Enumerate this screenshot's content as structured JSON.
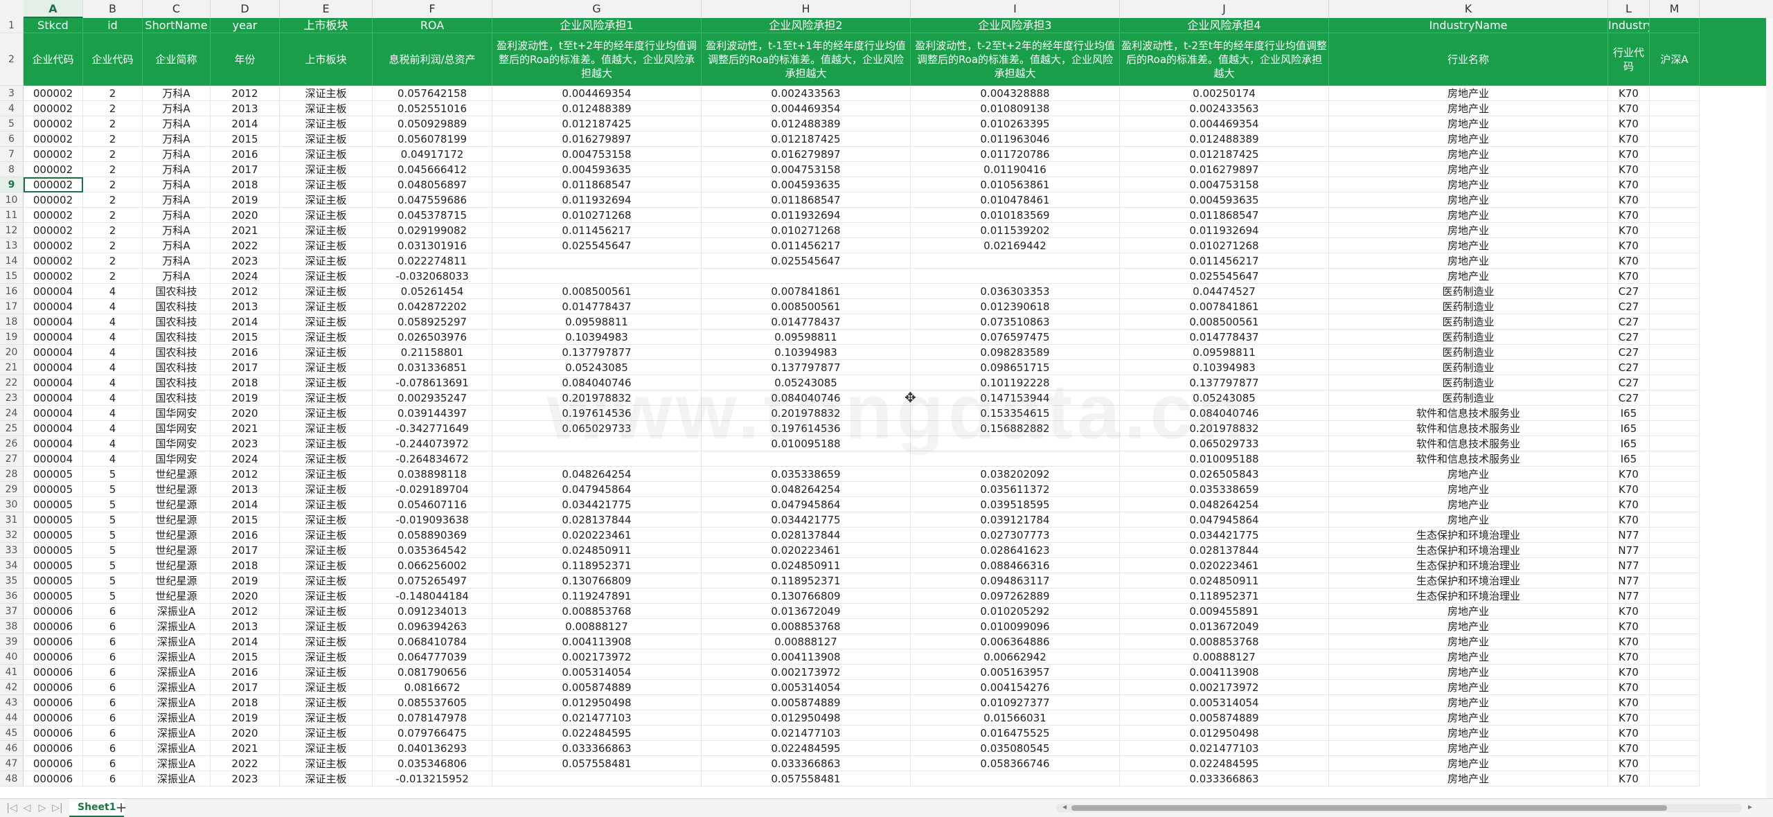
{
  "columns": [
    {
      "letter": "A",
      "name": "Stkcd",
      "name2": "企业代码"
    },
    {
      "letter": "B",
      "name": "id",
      "name2": "企业代码"
    },
    {
      "letter": "C",
      "name": "ShortName",
      "name2": "企业简称"
    },
    {
      "letter": "D",
      "name": "year",
      "name2": "年份"
    },
    {
      "letter": "E",
      "name": "上市板块",
      "name2": "上市板块"
    },
    {
      "letter": "F",
      "name": "ROA",
      "name2": "息税前利润/总资产"
    },
    {
      "letter": "G",
      "name": "企业风险承担1",
      "name2": "盈利波动性，t至t+2年的经年度行业均值调整后的Roa的标准差。值越大，企业风险承担越大"
    },
    {
      "letter": "H",
      "name": "企业风险承担2",
      "name2": "盈利波动性，t-1至t+1年的经年度行业均值调整后的Roa的标准差。值越大，企业风险承担越大"
    },
    {
      "letter": "I",
      "name": "企业风险承担3",
      "name2": "盈利波动性，t-2至t+2年的经年度行业均值调整后的Roa的标准差。值越大，企业风险承担越大"
    },
    {
      "letter": "J",
      "name": "企业风险承担4",
      "name2": "盈利波动性，t-2至t年的经年度行业均值调整后的Roa的标准差。值越大，企业风险承担越大"
    },
    {
      "letter": "K",
      "name": "IndustryName",
      "name2": "行业名称"
    },
    {
      "letter": "L",
      "name": "IndustryCode",
      "name2": "行业代码"
    },
    {
      "letter": "M",
      "name": "",
      "name2": "沪深A"
    }
  ],
  "rows": [
    [
      "000002",
      "2",
      "万科A",
      "2012",
      "深证主板",
      "0.057642158",
      "0.004469354",
      "0.002433563",
      "0.004328888",
      "0.00250174",
      "房地产业",
      "K70"
    ],
    [
      "000002",
      "2",
      "万科A",
      "2013",
      "深证主板",
      "0.052551016",
      "0.012488389",
      "0.004469354",
      "0.010809138",
      "0.002433563",
      "房地产业",
      "K70"
    ],
    [
      "000002",
      "2",
      "万科A",
      "2014",
      "深证主板",
      "0.050929889",
      "0.012187425",
      "0.012488389",
      "0.010263395",
      "0.004469354",
      "房地产业",
      "K70"
    ],
    [
      "000002",
      "2",
      "万科A",
      "2015",
      "深证主板",
      "0.056078199",
      "0.016279897",
      "0.012187425",
      "0.011963046",
      "0.012488389",
      "房地产业",
      "K70"
    ],
    [
      "000002",
      "2",
      "万科A",
      "2016",
      "深证主板",
      "0.04917172",
      "0.004753158",
      "0.016279897",
      "0.011720786",
      "0.012187425",
      "房地产业",
      "K70"
    ],
    [
      "000002",
      "2",
      "万科A",
      "2017",
      "深证主板",
      "0.045666412",
      "0.004593635",
      "0.004753158",
      "0.01190416",
      "0.016279897",
      "房地产业",
      "K70"
    ],
    [
      "000002",
      "2",
      "万科A",
      "2018",
      "深证主板",
      "0.048056897",
      "0.011868547",
      "0.004593635",
      "0.010563861",
      "0.004753158",
      "房地产业",
      "K70"
    ],
    [
      "000002",
      "2",
      "万科A",
      "2019",
      "深证主板",
      "0.047559686",
      "0.011932694",
      "0.011868547",
      "0.010478461",
      "0.004593635",
      "房地产业",
      "K70"
    ],
    [
      "000002",
      "2",
      "万科A",
      "2020",
      "深证主板",
      "0.045378715",
      "0.010271268",
      "0.011932694",
      "0.010183569",
      "0.011868547",
      "房地产业",
      "K70"
    ],
    [
      "000002",
      "2",
      "万科A",
      "2021",
      "深证主板",
      "0.029199082",
      "0.011456217",
      "0.010271268",
      "0.011539202",
      "0.011932694",
      "房地产业",
      "K70"
    ],
    [
      "000002",
      "2",
      "万科A",
      "2022",
      "深证主板",
      "0.031301916",
      "0.025545647",
      "0.011456217",
      "0.02169442",
      "0.010271268",
      "房地产业",
      "K70"
    ],
    [
      "000002",
      "2",
      "万科A",
      "2023",
      "深证主板",
      "0.022274811",
      "",
      "0.025545647",
      "",
      "0.011456217",
      "房地产业",
      "K70"
    ],
    [
      "000002",
      "2",
      "万科A",
      "2024",
      "深证主板",
      "-0.032068033",
      "",
      "",
      "",
      "0.025545647",
      "房地产业",
      "K70"
    ],
    [
      "000004",
      "4",
      "国农科技",
      "2012",
      "深证主板",
      "0.05261454",
      "0.008500561",
      "0.007841861",
      "0.036303353",
      "0.04474527",
      "医药制造业",
      "C27"
    ],
    [
      "000004",
      "4",
      "国农科技",
      "2013",
      "深证主板",
      "0.042872202",
      "0.014778437",
      "0.008500561",
      "0.012390618",
      "0.007841861",
      "医药制造业",
      "C27"
    ],
    [
      "000004",
      "4",
      "国农科技",
      "2014",
      "深证主板",
      "0.058925297",
      "0.09598811",
      "0.014778437",
      "0.073510863",
      "0.008500561",
      "医药制造业",
      "C27"
    ],
    [
      "000004",
      "4",
      "国农科技",
      "2015",
      "深证主板",
      "0.026503976",
      "0.10394983",
      "0.09598811",
      "0.076597475",
      "0.014778437",
      "医药制造业",
      "C27"
    ],
    [
      "000004",
      "4",
      "国农科技",
      "2016",
      "深证主板",
      "0.21158801",
      "0.137797877",
      "0.10394983",
      "0.098283589",
      "0.09598811",
      "医药制造业",
      "C27"
    ],
    [
      "000004",
      "4",
      "国农科技",
      "2017",
      "深证主板",
      "0.031336851",
      "0.05243085",
      "0.137797877",
      "0.098651715",
      "0.10394983",
      "医药制造业",
      "C27"
    ],
    [
      "000004",
      "4",
      "国农科技",
      "2018",
      "深证主板",
      "-0.078613691",
      "0.084040746",
      "0.05243085",
      "0.101192228",
      "0.137797877",
      "医药制造业",
      "C27"
    ],
    [
      "000004",
      "4",
      "国农科技",
      "2019",
      "深证主板",
      "0.002935247",
      "0.201978832",
      "0.084040746",
      "0.147153944",
      "0.05243085",
      "医药制造业",
      "C27"
    ],
    [
      "000004",
      "4",
      "国华网安",
      "2020",
      "深证主板",
      "0.039144397",
      "0.197614536",
      "0.201978832",
      "0.153354615",
      "0.084040746",
      "软件和信息技术服务业",
      "I65"
    ],
    [
      "000004",
      "4",
      "国华网安",
      "2021",
      "深证主板",
      "-0.342771649",
      "0.065029733",
      "0.197614536",
      "0.156882882",
      "0.201978832",
      "软件和信息技术服务业",
      "I65"
    ],
    [
      "000004",
      "4",
      "国华网安",
      "2023",
      "深证主板",
      "-0.244073972",
      "",
      "0.010095188",
      "",
      "0.065029733",
      "软件和信息技术服务业",
      "I65"
    ],
    [
      "000004",
      "4",
      "国华网安",
      "2024",
      "深证主板",
      "-0.264834672",
      "",
      "",
      "",
      "0.010095188",
      "软件和信息技术服务业",
      "I65"
    ],
    [
      "000005",
      "5",
      "世纪星源",
      "2012",
      "深证主板",
      "0.038898118",
      "0.048264254",
      "0.035338659",
      "0.038202092",
      "0.026505843",
      "房地产业",
      "K70"
    ],
    [
      "000005",
      "5",
      "世纪星源",
      "2013",
      "深证主板",
      "-0.029189704",
      "0.047945864",
      "0.048264254",
      "0.035611372",
      "0.035338659",
      "房地产业",
      "K70"
    ],
    [
      "000005",
      "5",
      "世纪星源",
      "2014",
      "深证主板",
      "0.054607116",
      "0.034421775",
      "0.047945864",
      "0.039518595",
      "0.048264254",
      "房地产业",
      "K70"
    ],
    [
      "000005",
      "5",
      "世纪星源",
      "2015",
      "深证主板",
      "-0.019093638",
      "0.028137844",
      "0.034421775",
      "0.039121784",
      "0.047945864",
      "房地产业",
      "K70"
    ],
    [
      "000005",
      "5",
      "世纪星源",
      "2016",
      "深证主板",
      "0.058890369",
      "0.020223461",
      "0.028137844",
      "0.027307773",
      "0.034421775",
      "生态保护和环境治理业",
      "N77"
    ],
    [
      "000005",
      "5",
      "世纪星源",
      "2017",
      "深证主板",
      "0.035364542",
      "0.024850911",
      "0.020223461",
      "0.028641623",
      "0.028137844",
      "生态保护和环境治理业",
      "N77"
    ],
    [
      "000005",
      "5",
      "世纪星源",
      "2018",
      "深证主板",
      "0.066256002",
      "0.118952371",
      "0.024850911",
      "0.088466316",
      "0.020223461",
      "生态保护和环境治理业",
      "N77"
    ],
    [
      "000005",
      "5",
      "世纪星源",
      "2019",
      "深证主板",
      "0.075265497",
      "0.130766809",
      "0.118952371",
      "0.094863117",
      "0.024850911",
      "生态保护和环境治理业",
      "N77"
    ],
    [
      "000005",
      "5",
      "世纪星源",
      "2020",
      "深证主板",
      "-0.148044184",
      "0.119247891",
      "0.130766809",
      "0.097262889",
      "0.118952371",
      "生态保护和环境治理业",
      "N77"
    ],
    [
      "000006",
      "6",
      "深振业A",
      "2012",
      "深证主板",
      "0.091234013",
      "0.008853768",
      "0.013672049",
      "0.010205292",
      "0.009455891",
      "房地产业",
      "K70"
    ],
    [
      "000006",
      "6",
      "深振业A",
      "2013",
      "深证主板",
      "0.096394263",
      "0.00888127",
      "0.008853768",
      "0.010099096",
      "0.013672049",
      "房地产业",
      "K70"
    ],
    [
      "000006",
      "6",
      "深振业A",
      "2014",
      "深证主板",
      "0.068410784",
      "0.004113908",
      "0.00888127",
      "0.006364886",
      "0.008853768",
      "房地产业",
      "K70"
    ],
    [
      "000006",
      "6",
      "深振业A",
      "2015",
      "深证主板",
      "0.064777039",
      "0.002173972",
      "0.004113908",
      "0.00662942",
      "0.00888127",
      "房地产业",
      "K70"
    ],
    [
      "000006",
      "6",
      "深振业A",
      "2016",
      "深证主板",
      "0.081790656",
      "0.005314054",
      "0.002173972",
      "0.005163957",
      "0.004113908",
      "房地产业",
      "K70"
    ],
    [
      "000006",
      "6",
      "深振业A",
      "2017",
      "深证主板",
      "0.0816672",
      "0.005874889",
      "0.005314054",
      "0.004154276",
      "0.002173972",
      "房地产业",
      "K70"
    ],
    [
      "000006",
      "6",
      "深振业A",
      "2018",
      "深证主板",
      "0.085537605",
      "0.012950498",
      "0.005874889",
      "0.010927377",
      "0.005314054",
      "房地产业",
      "K70"
    ],
    [
      "000006",
      "6",
      "深振业A",
      "2019",
      "深证主板",
      "0.078147978",
      "0.021477103",
      "0.012950498",
      "0.01566031",
      "0.005874889",
      "房地产业",
      "K70"
    ],
    [
      "000006",
      "6",
      "深振业A",
      "2020",
      "深证主板",
      "0.079766475",
      "0.022484595",
      "0.021477103",
      "0.016475525",
      "0.012950498",
      "房地产业",
      "K70"
    ],
    [
      "000006",
      "6",
      "深振业A",
      "2021",
      "深证主板",
      "0.040136293",
      "0.033366863",
      "0.022484595",
      "0.035080545",
      "0.021477103",
      "房地产业",
      "K70"
    ],
    [
      "000006",
      "6",
      "深振业A",
      "2022",
      "深证主板",
      "0.035346806",
      "0.057558481",
      "0.033366863",
      "0.058366746",
      "0.022484595",
      "房地产业",
      "K70"
    ],
    [
      "000006",
      "6",
      "深振业A",
      "2023",
      "深证主板",
      "-0.013215952",
      "",
      "0.057558481",
      "",
      "0.033366863",
      "房地产业",
      "K70"
    ]
  ],
  "sheet": {
    "tab_name": "Sheet1",
    "add_label": "+"
  },
  "nav": {
    "first": "|◁",
    "prev": "◁",
    "next": "▷",
    "last": "▷|"
  },
  "watermark": "www.tongdata.cn",
  "selected_row": 9,
  "selected_col": "A",
  "colors": {
    "header_green": "#1a9e4a",
    "accent": "#1e7145"
  }
}
